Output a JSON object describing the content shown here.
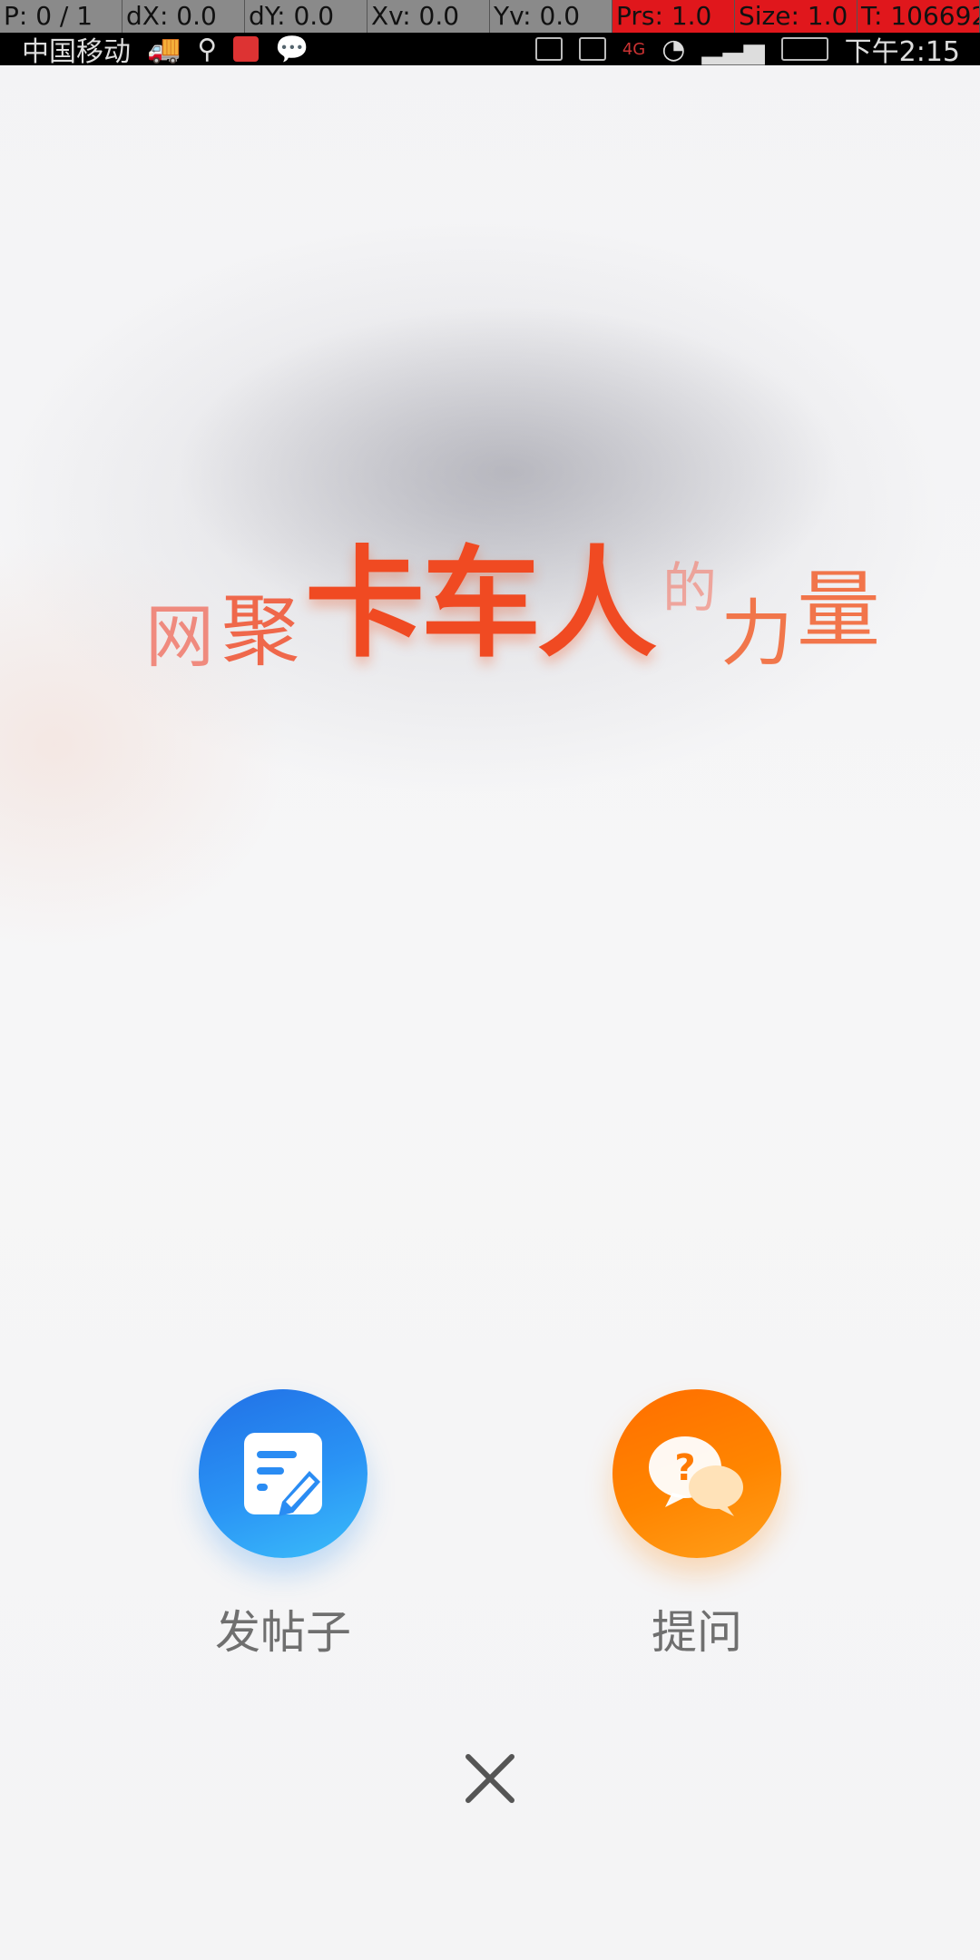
{
  "debug_bar": {
    "cells": [
      "P: 0 / 1",
      "dX: 0.0",
      "dY: 0.0",
      "Xv: 0.0",
      "Yv: 0.0",
      "Prs: 1.0",
      "Size: 1.0",
      "T: 106692"
    ]
  },
  "status_bar": {
    "carrier": "中国移动",
    "time": "下午2:15",
    "signal_label": "4G"
  },
  "headline": {
    "part1": "网",
    "part2": "聚",
    "part3": "卡车人",
    "part4": "的",
    "part5": "力",
    "part6": "量"
  },
  "actions": [
    {
      "label": "发帖子",
      "icon": "post-edit-icon",
      "color": "#2a8cf3"
    },
    {
      "label": "提问",
      "icon": "question-chat-icon",
      "color": "#ff8500"
    }
  ],
  "close_icon": "close-icon"
}
